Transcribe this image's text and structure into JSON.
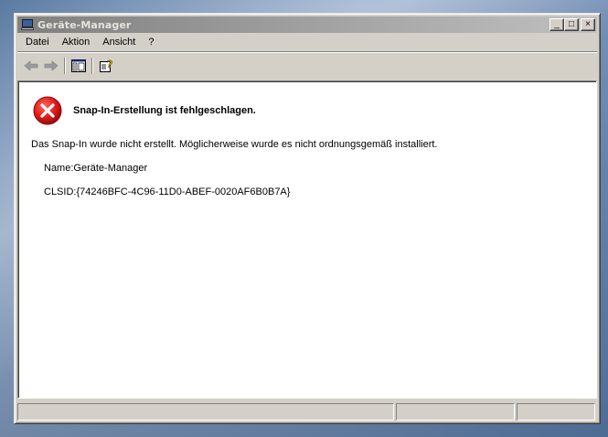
{
  "window": {
    "title": "Geräte-Manager"
  },
  "title_buttons": {
    "minimize": "_",
    "maximize": "□",
    "close": "×"
  },
  "menu": {
    "items": [
      {
        "label": "Datei"
      },
      {
        "label": "Aktion"
      },
      {
        "label": "Ansicht"
      },
      {
        "label": "?"
      }
    ]
  },
  "toolbar": {
    "icons": [
      "back-arrow-icon",
      "forward-arrow-icon",
      "show-hide-console-tree-icon",
      "help-icon"
    ]
  },
  "error": {
    "icon": "error-x-icon",
    "title": "Snap-In-Erstellung ist fehlgeschlagen.",
    "message": "Das Snap-In wurde nicht erstellt. Möglicherweise wurde es nicht ordnungsgemäß installiert.",
    "name_line": "Name:Geräte-Manager",
    "clsid_line": "CLSID:{74246BFC-4C96-11D0-ABEF-0020AF6B0B7A}"
  },
  "colors": {
    "error_red": "#e01c1c",
    "face": "#d4d0c8",
    "inactive_title_start": "#808080",
    "inactive_title_end": "#c0c0c0"
  }
}
